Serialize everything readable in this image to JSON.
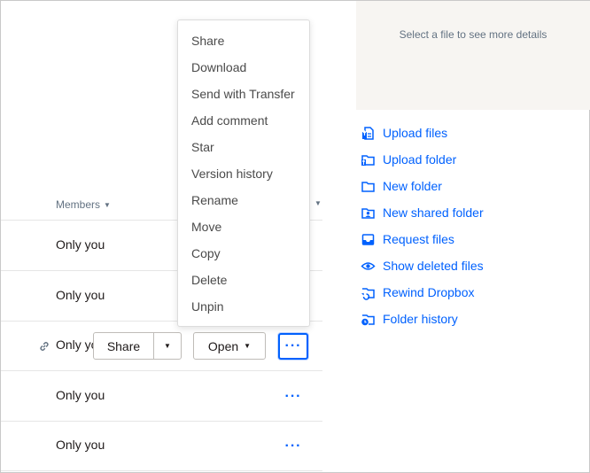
{
  "file_list": {
    "members_header": "Members",
    "rows": [
      {
        "members": "Only you"
      },
      {
        "members": "Only you"
      },
      {
        "members": "Only yo"
      },
      {
        "members": "Only you"
      },
      {
        "members": "Only you"
      }
    ],
    "share_label": "Share",
    "open_label": "Open",
    "more_label": "···"
  },
  "context_menu": {
    "items": [
      "Share",
      "Download",
      "Send with Transfer",
      "Add comment",
      "Star",
      "Version history",
      "Rename",
      "Move",
      "Copy",
      "Delete",
      "Unpin"
    ]
  },
  "details_panel": {
    "text": "Select a file to see more details"
  },
  "actions": [
    {
      "label": "Upload files",
      "icon": "upload-file-icon"
    },
    {
      "label": "Upload folder",
      "icon": "upload-folder-icon"
    },
    {
      "label": "New folder",
      "icon": "folder-icon"
    },
    {
      "label": "New shared folder",
      "icon": "shared-folder-icon"
    },
    {
      "label": "Request files",
      "icon": "inbox-icon"
    },
    {
      "label": "Show deleted files",
      "icon": "eye-icon"
    },
    {
      "label": "Rewind Dropbox",
      "icon": "rewind-icon"
    },
    {
      "label": "Folder history",
      "icon": "folder-history-icon"
    }
  ],
  "colors": {
    "accent": "#0061fe",
    "panel_bg": "#f7f5f2",
    "muted_text": "#637282"
  }
}
